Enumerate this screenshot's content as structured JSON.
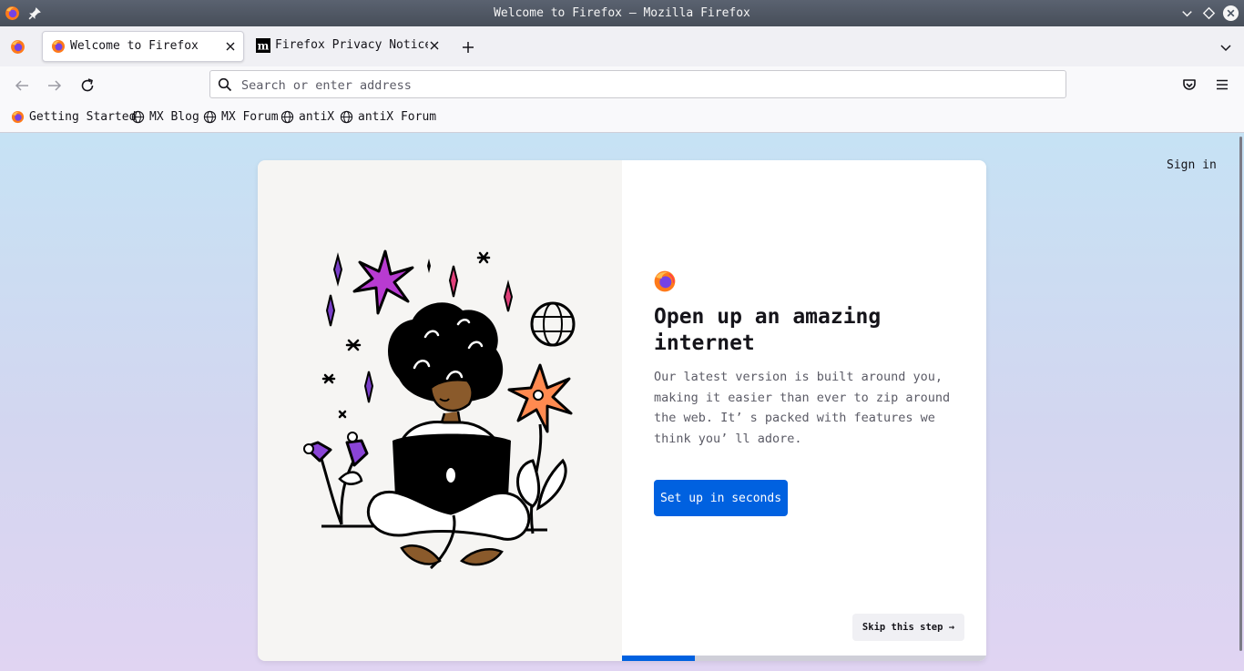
{
  "window": {
    "title": "Welcome to Firefox — Mozilla Firefox"
  },
  "tabs": [
    {
      "label": "Welcome to Firefox",
      "active": true
    },
    {
      "label": "Firefox Privacy Notice —",
      "active": false
    }
  ],
  "urlbar": {
    "placeholder": "Search or enter address",
    "value": ""
  },
  "bookmarks": [
    {
      "label": "Getting Started",
      "icon": "firefox-icon"
    },
    {
      "label": "MX Blog",
      "icon": "globe-icon"
    },
    {
      "label": "MX Forum",
      "icon": "globe-icon"
    },
    {
      "label": "antiX",
      "icon": "globe-icon"
    },
    {
      "label": "antiX Forum",
      "icon": "globe-icon"
    }
  ],
  "page": {
    "signin": "Sign in",
    "heading": "Open up an amazing internet",
    "subtext": "Our latest version is built around you, making it easier than ever to zip around the web. It’ s packed with features we think you’ ll adore.",
    "primary_button": "Set up in seconds",
    "skip_button": "Skip this step →",
    "progress": 0.2
  },
  "colors": {
    "accent": "#0061e0",
    "titlebar": "#4b5563",
    "illustration_bg": "#f6f5f3"
  }
}
